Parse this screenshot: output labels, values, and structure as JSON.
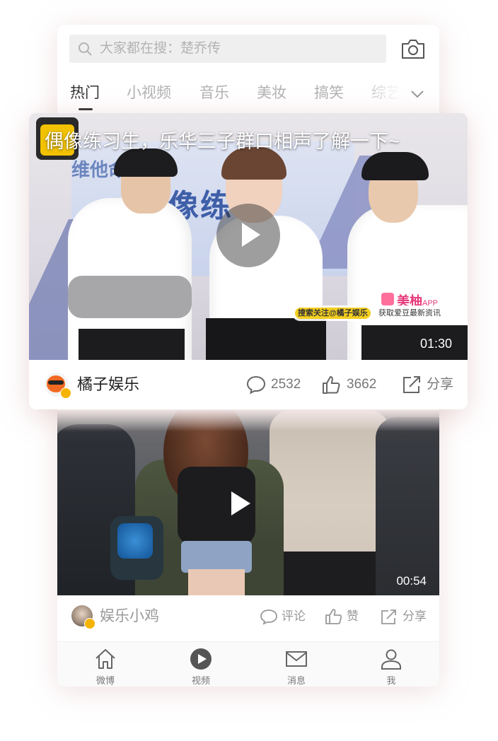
{
  "search": {
    "placeholder": "大家都在搜：楚乔传"
  },
  "tabs": [
    {
      "label": "热门",
      "active": true
    },
    {
      "label": "小视频",
      "active": false
    },
    {
      "label": "音乐",
      "active": false
    },
    {
      "label": "美妆",
      "active": false
    },
    {
      "label": "搞笑",
      "active": false
    },
    {
      "label": "综艺",
      "active": false
    }
  ],
  "feature_card": {
    "title": "偶像练习生，乐华三子群口相声了解一下~",
    "duration": "01:30",
    "watermark": "美柚",
    "watermark_suffix": "APP",
    "promo_highlight": "搜索关注@橘子娱乐",
    "promo_text": "获取爱豆最新资讯",
    "author": "橘子娱乐",
    "comments": "2532",
    "likes": "3662",
    "share": "分享"
  },
  "second_card": {
    "duration": "00:54",
    "author": "娱乐小鸡",
    "comment": "评论",
    "like": "赞",
    "share": "分享"
  },
  "tabbar": [
    {
      "label": "微博",
      "icon": "home-icon"
    },
    {
      "label": "视频",
      "icon": "video-play-icon",
      "active": true
    },
    {
      "label": "消息",
      "icon": "mail-icon"
    },
    {
      "label": "我",
      "icon": "profile-icon"
    }
  ],
  "colors": {
    "accent": "#333333",
    "muted": "#999999",
    "badge": "#f5b400",
    "brand_pink": "#e8387a"
  }
}
